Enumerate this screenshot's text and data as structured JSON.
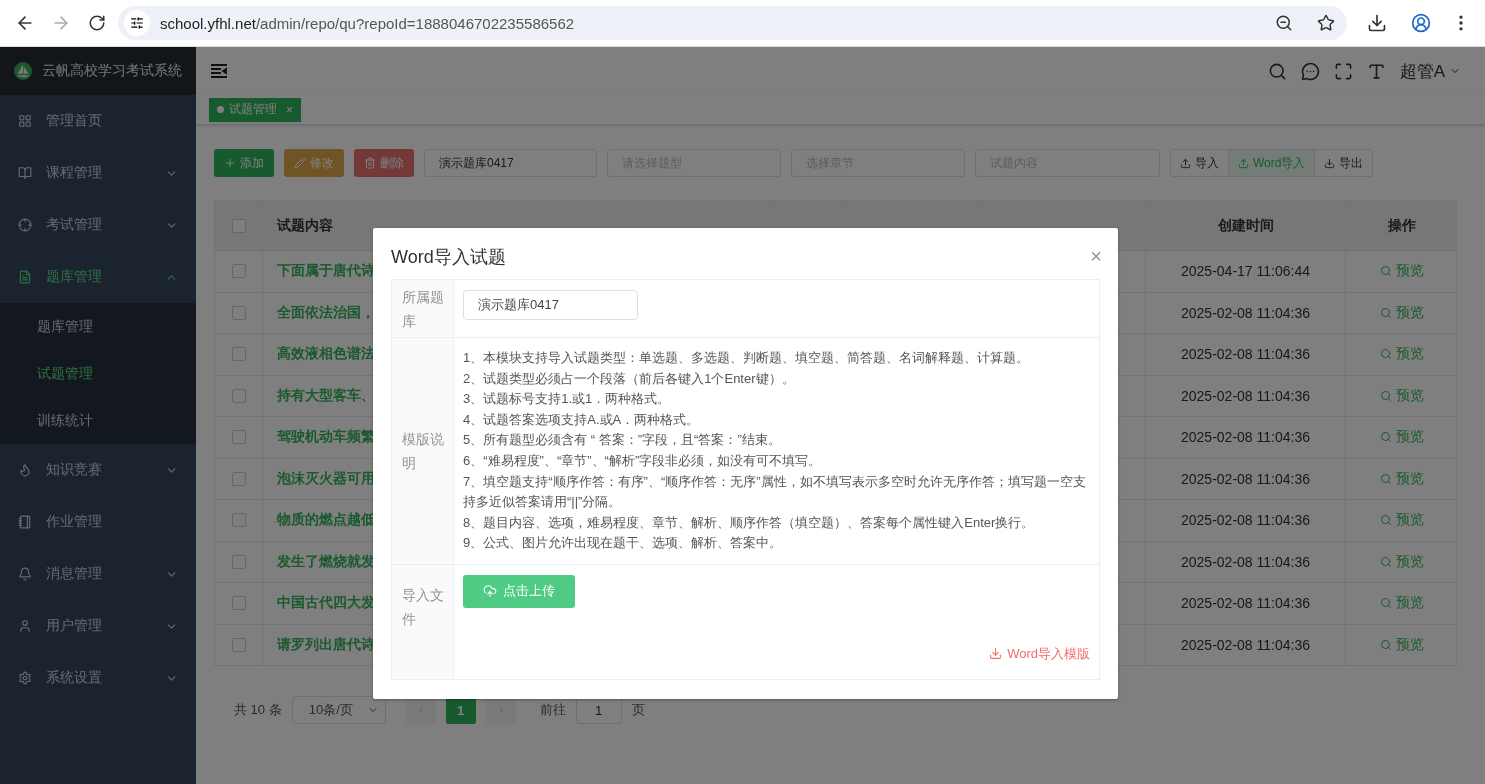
{
  "browser": {
    "url_host": "school.yfhl.net",
    "url_path": "/admin/repo/qu?repoId=1888046702235586562"
  },
  "sidebar": {
    "title": "云帆高校学习考试系统",
    "items": [
      {
        "label": "管理首页",
        "selected": false
      },
      {
        "label": "课程管理",
        "expanded": false,
        "selected": false
      },
      {
        "label": "考试管理",
        "expanded": false,
        "selected": false
      },
      {
        "label": "题库管理",
        "expanded": true,
        "selected": true,
        "children": [
          {
            "label": "题库管理",
            "selected": false
          },
          {
            "label": "试题管理",
            "selected": true
          },
          {
            "label": "训练统计",
            "selected": false
          }
        ]
      },
      {
        "label": "知识竞赛",
        "expanded": false,
        "selected": false
      },
      {
        "label": "作业管理",
        "selected": false
      },
      {
        "label": "消息管理",
        "expanded": false,
        "selected": false
      },
      {
        "label": "用户管理",
        "expanded": false,
        "selected": false
      },
      {
        "label": "系统设置",
        "expanded": false,
        "selected": false
      }
    ]
  },
  "header": {
    "user": "超管A"
  },
  "tags": [
    {
      "label": "试题管理",
      "selected": true,
      "close": "×"
    }
  ],
  "toolbar": {
    "buttons": [
      {
        "label": "添加",
        "kind": "primary",
        "disabled": false
      },
      {
        "label": "修改",
        "kind": "warning",
        "disabled": true
      },
      {
        "label": "删除",
        "kind": "danger",
        "disabled": true
      }
    ],
    "filters": [
      {
        "value": "演示题库0417"
      },
      {
        "placeholder": "请选择题型"
      },
      {
        "placeholder": "选择章节"
      },
      {
        "placeholder": "试题内容"
      }
    ],
    "actions": [
      {
        "label": "导入",
        "kind": "upload",
        "selected": false
      },
      {
        "label": "Word导入",
        "kind": "upload",
        "selected": true
      },
      {
        "label": "导出",
        "kind": "download",
        "selected": false
      }
    ]
  },
  "table": {
    "select_all": {
      "checked": false
    },
    "columns": [
      "试题内容",
      "创建时间",
      "操作"
    ],
    "rows": [
      {
        "content": "下面属于唐代诗",
        "created": "2025-04-17 11:06:44",
        "action": "预览",
        "checked": false
      },
      {
        "content": "全面依法治国，",
        "created": "2025-02-08 11:04:36",
        "action": "预览",
        "checked": false
      },
      {
        "content": "高效液相色谱法",
        "created": "2025-02-08 11:04:36",
        "action": "预览",
        "checked": false
      },
      {
        "content": "持有大型客车、",
        "created": "2025-02-08 11:04:36",
        "action": "预览",
        "checked": false
      },
      {
        "content": "驾驶机动车频繁",
        "created": "2025-02-08 11:04:36",
        "action": "预览",
        "checked": false
      },
      {
        "content": "泡沫灭火器可用",
        "created": "2025-02-08 11:04:36",
        "action": "预览",
        "checked": false
      },
      {
        "content": "物质的燃点越低",
        "created": "2025-02-08 11:04:36",
        "action": "预览",
        "checked": false
      },
      {
        "content": "发生了燃烧就发",
        "created": "2025-02-08 11:04:36",
        "action": "预览",
        "checked": false
      },
      {
        "content": "中国古代四大发",
        "created": "2025-02-08 11:04:36",
        "action": "预览",
        "checked": false
      },
      {
        "content": "请罗列出唐代诗",
        "created": "2025-02-08 11:04:36",
        "action": "预览",
        "checked": false
      }
    ]
  },
  "pagination": {
    "total": "共 10 条",
    "page_size": "10条/页",
    "pages": [
      {
        "label": "1",
        "selected": true
      }
    ],
    "goto_label": "前往",
    "goto_value": "1",
    "goto_suffix": "页"
  },
  "modal": {
    "title": "Word导入试题",
    "close": "×",
    "fields": [
      {
        "label": "所属题库",
        "kind": "input",
        "value": "演示题库0417"
      },
      {
        "label": "模版说明",
        "kind": "list",
        "lines": [
          "1、本模块支持导入试题类型：单选题、多选题、判断题、填空题、简答题、名词解释题、计算题。",
          "2、试题类型必须占一个段落（前后各键入1个Enter键）。",
          "3、试题标号支持1.或1．两种格式。",
          "4、试题答案选项支持A.或A．两种格式。",
          "5、所有题型必须含有 “ 答案：”字段，且“答案：”结束。",
          "6、“难易程度”、“章节”、“解析”字段非必须，如没有可不填写。",
          "7、填空题支持“顺序作答：有序”、“顺序作答：无序”属性，如不填写表示多空时允许无序作答；填写题一空支持多近似答案请用“||”分隔。",
          "8、题目内容、选项，难易程度、章节、解析、顺序作答（填空题）、答案每个属性键入Enter换行。",
          "9、公式、图片允许出现在题干、选项、解析、答案中。"
        ]
      },
      {
        "label": "导入文件",
        "kind": "upload",
        "button": "点击上传",
        "link": "Word导入模版"
      }
    ]
  }
}
